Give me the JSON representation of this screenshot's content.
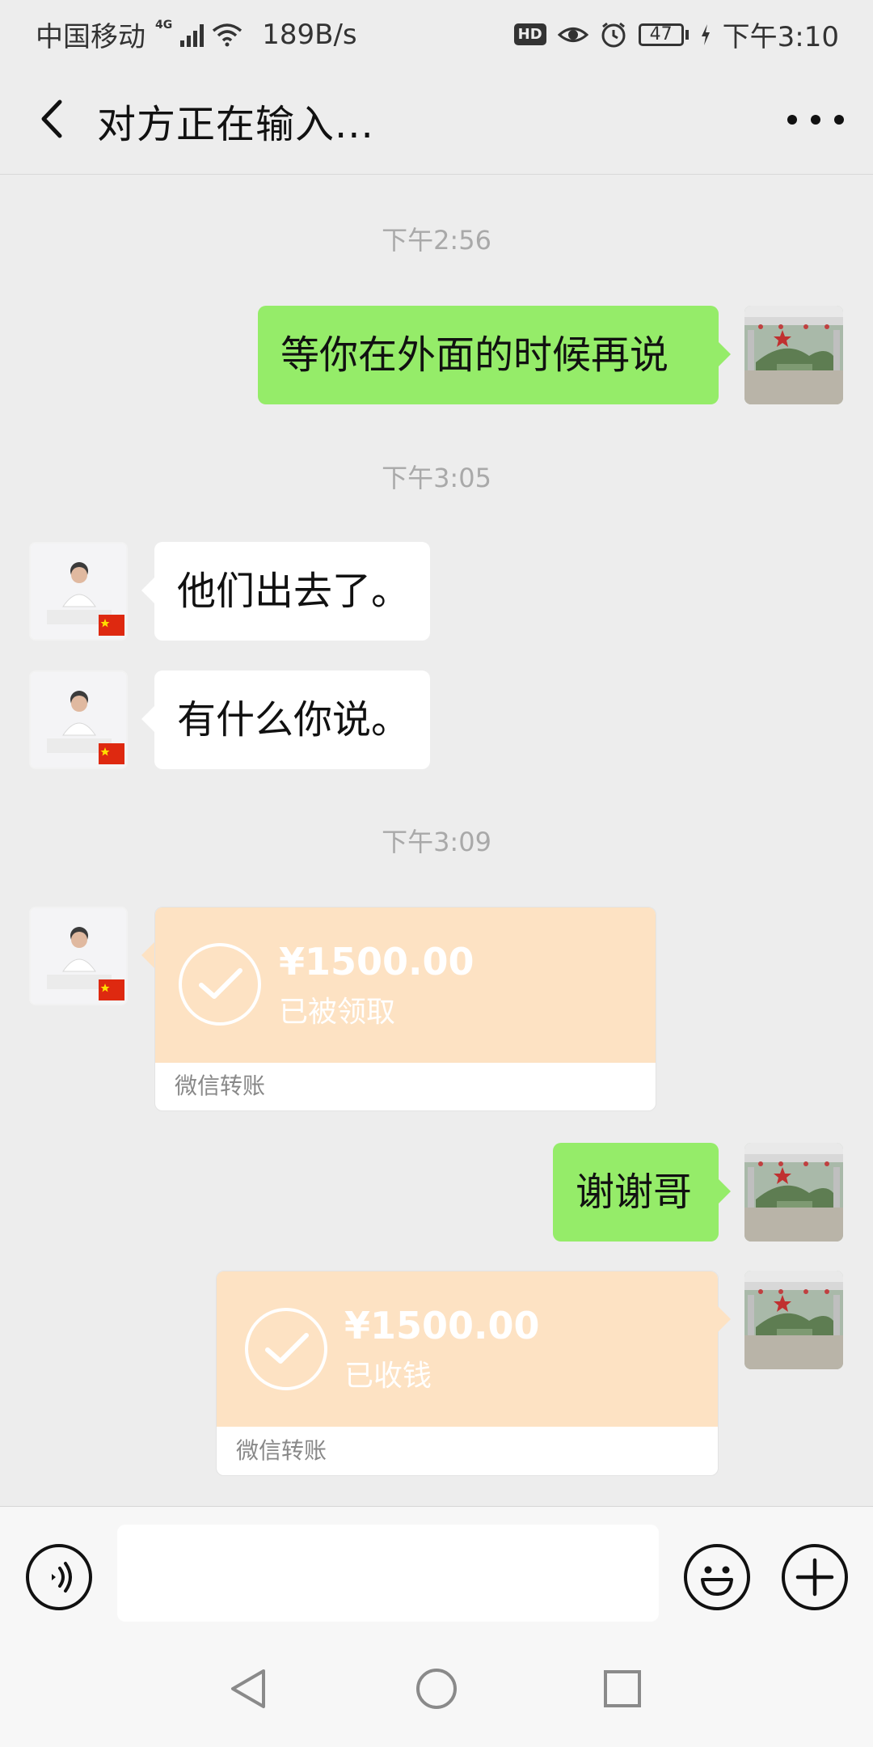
{
  "status_bar": {
    "carrier": "中国移动",
    "network": "4G",
    "speed": "189B/s",
    "hd": "HD",
    "battery": "47",
    "time": "下午3:10"
  },
  "header": {
    "title": "对方正在输入..."
  },
  "messages": {
    "ts1": "下午2:56",
    "m1": "等你在外面的时候再说",
    "ts2": "下午3:05",
    "m2": "他们出去了。",
    "m3": "有什么你说。",
    "ts3": "下午3:09",
    "t1_amount": "¥1500.00",
    "t1_status": "已被领取",
    "t1_footer": "微信转账",
    "m4": "谢谢哥",
    "t2_amount": "¥1500.00",
    "t2_status": "已收钱",
    "t2_footer": "微信转账"
  },
  "input": {
    "placeholder": ""
  },
  "colors": {
    "sent_bubble": "#95ec69",
    "received_bubble": "#ffffff",
    "transfer_card": "#fde2c3",
    "background": "#ededed"
  }
}
